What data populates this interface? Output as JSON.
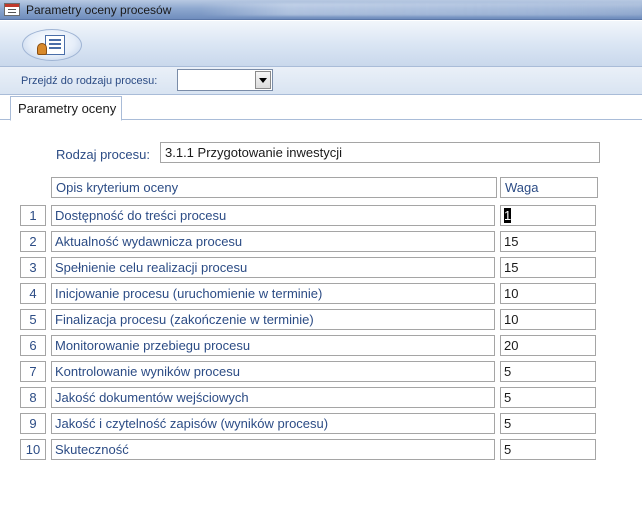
{
  "window": {
    "title": "Parametry oceny procesów"
  },
  "nav": {
    "label": "Przejdź do rodzaju procesu:",
    "combo_value": ""
  },
  "tab": {
    "label": "Parametry oceny"
  },
  "form": {
    "process_label": "Rodzaj procesu:",
    "process_value": "3.1.1 Przygotowanie inwestycji",
    "criterion_header": "Opis kryterium oceny",
    "weight_header": "Waga",
    "rows": [
      {
        "num": "1",
        "criterion": "Dostępność do treści procesu",
        "weight": "1"
      },
      {
        "num": "2",
        "criterion": "Aktualność wydawnicza procesu",
        "weight": "15"
      },
      {
        "num": "3",
        "criterion": "Spełnienie celu realizacji procesu",
        "weight": "15"
      },
      {
        "num": "4",
        "criterion": "Inicjowanie procesu (uruchomienie w terminie)",
        "weight": "10"
      },
      {
        "num": "5",
        "criterion": "Finalizacja procesu (zakończenie w terminie)",
        "weight": "10"
      },
      {
        "num": "6",
        "criterion": "Monitorowanie przebiegu procesu",
        "weight": "20"
      },
      {
        "num": "7",
        "criterion": "Kontrolowanie wyników procesu",
        "weight": "5"
      },
      {
        "num": "8",
        "criterion": "Jakość dokumentów wejściowych",
        "weight": "5"
      },
      {
        "num": "9",
        "criterion": "Jakość i czytelność zapisów (wyników procesu)",
        "weight": "5"
      },
      {
        "num": "10",
        "criterion": "Skuteczność",
        "weight": "5"
      }
    ]
  },
  "colors": {
    "label_blue": "#2c4c85",
    "border": "#a5a5a5",
    "ribbon": "#dbe6f4"
  }
}
